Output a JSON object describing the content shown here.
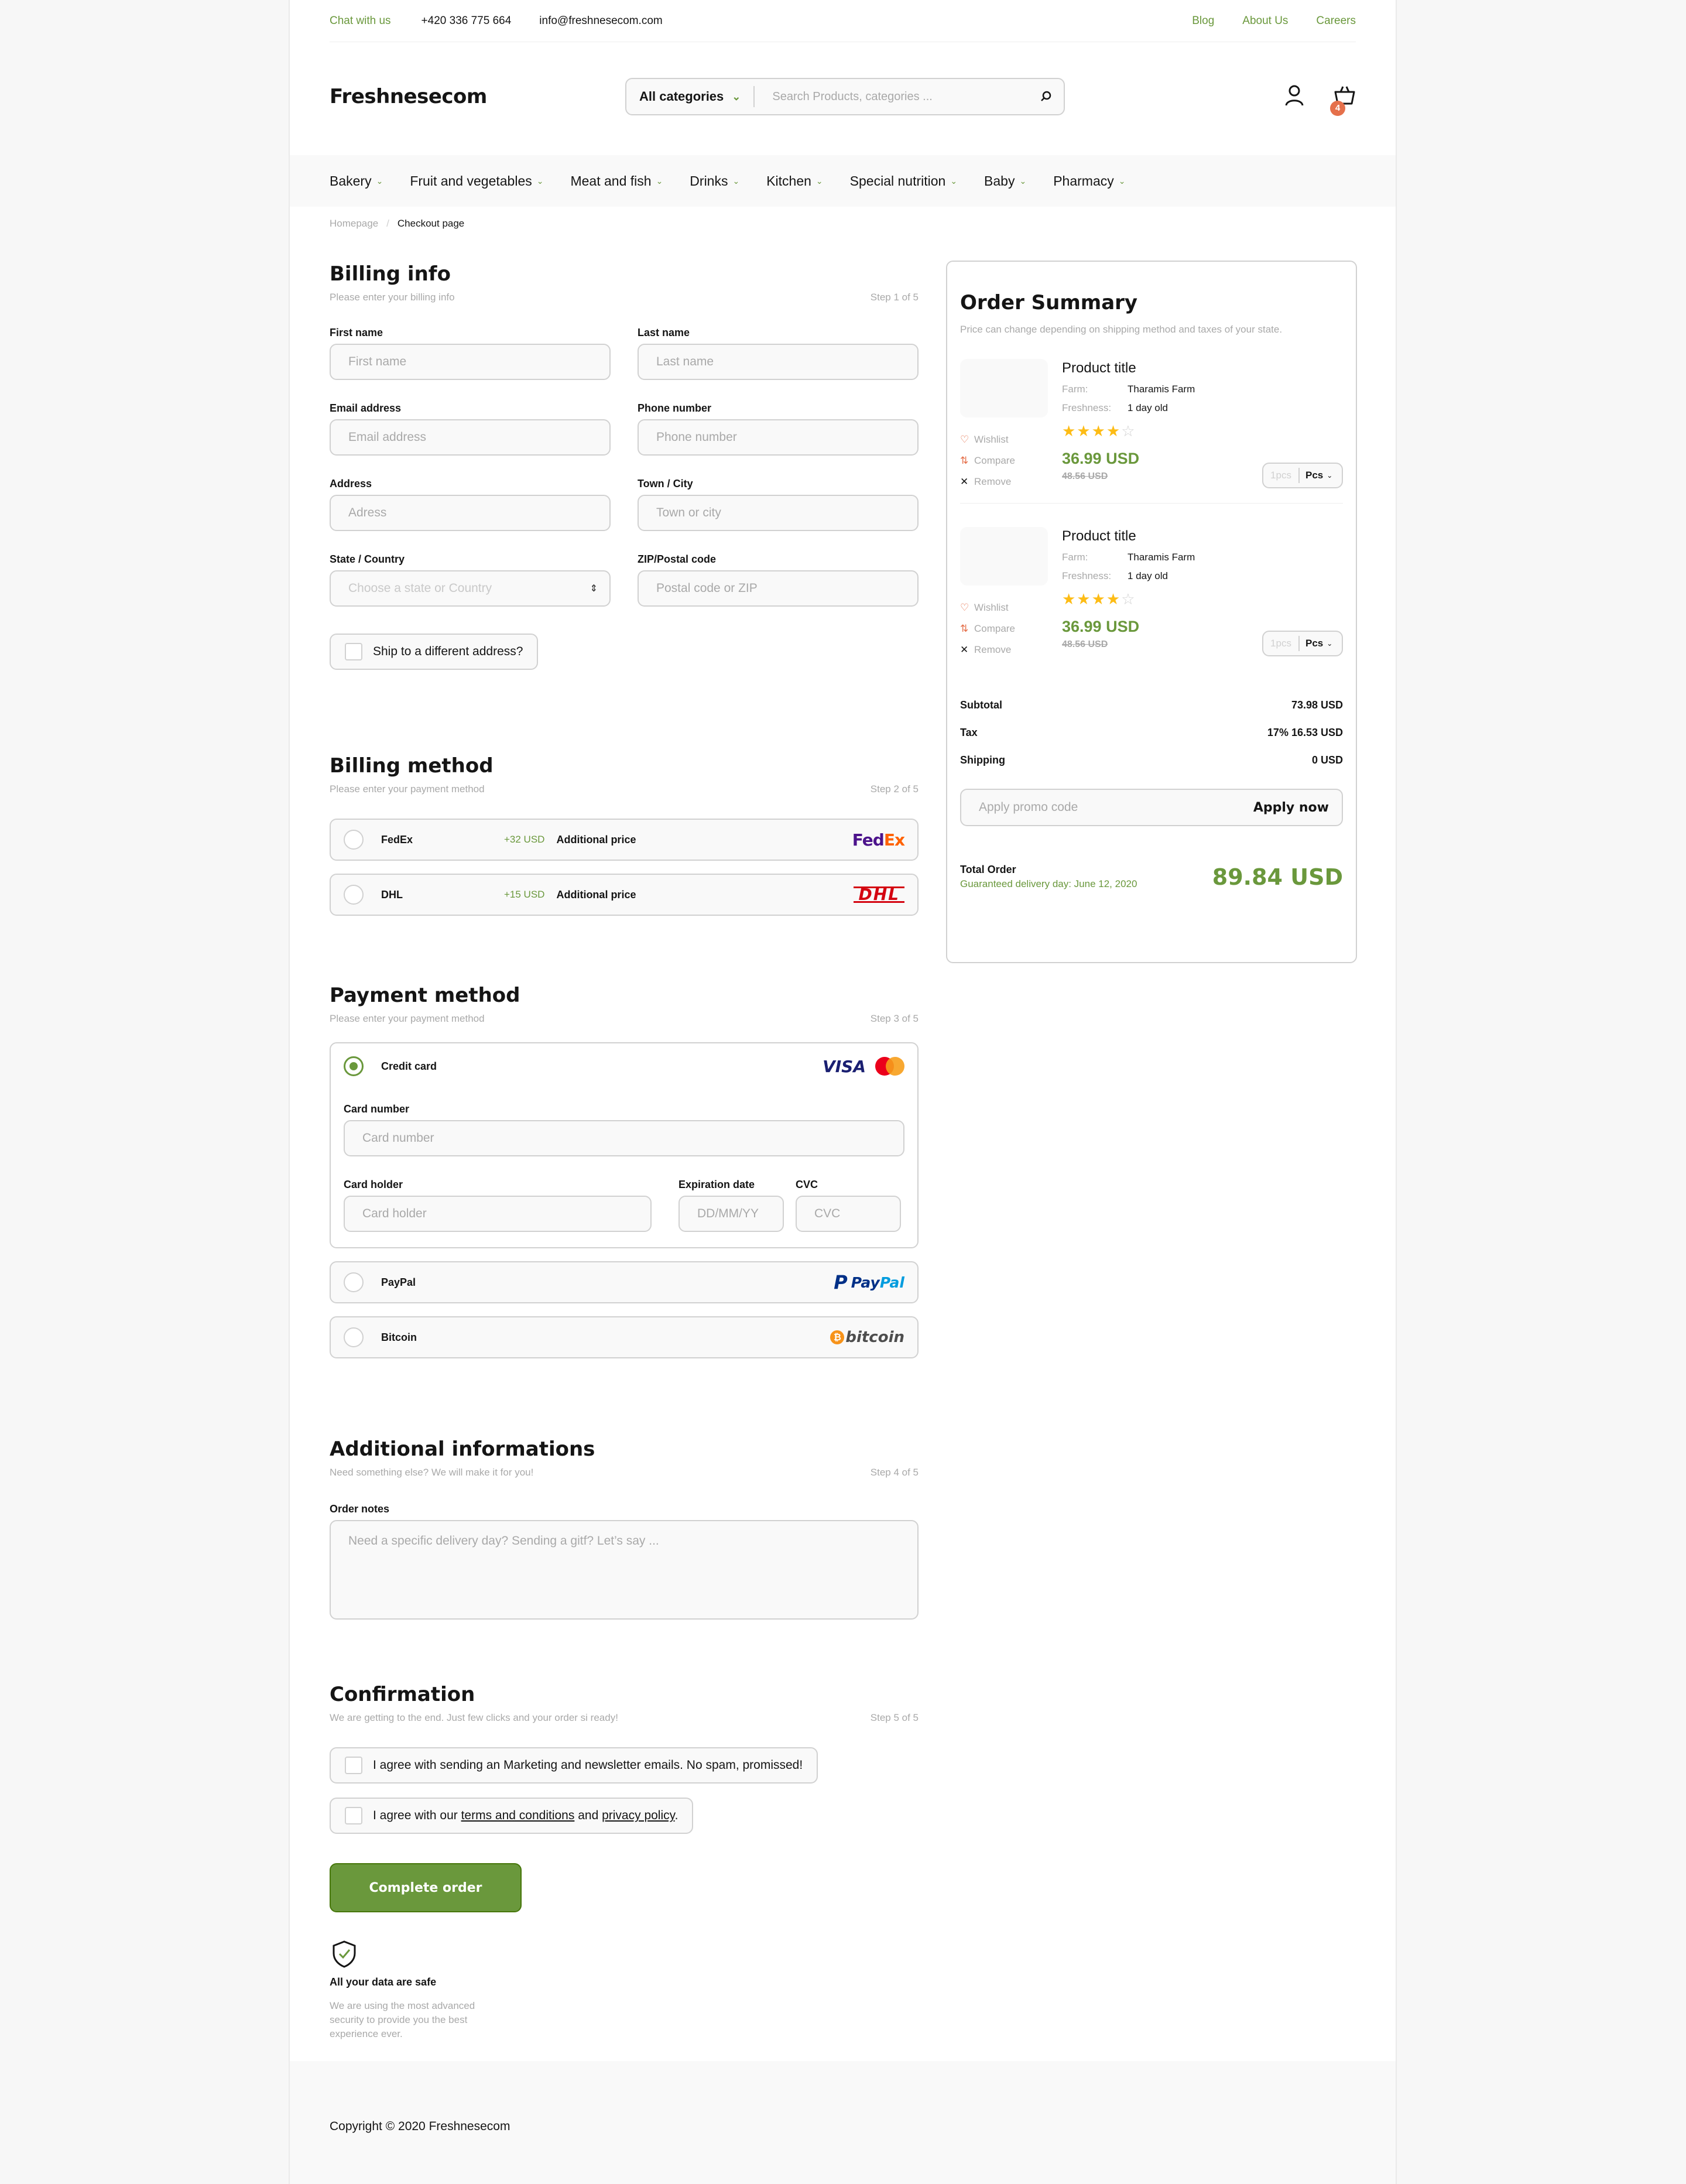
{
  "topbar": {
    "chat": "Chat with us",
    "phone": "+420 336 775 664",
    "email": "info@freshnesecom.com",
    "links": [
      "Blog",
      "About Us",
      "Careers"
    ]
  },
  "header": {
    "logo": "Freshnesecom",
    "category": "All categories",
    "search_placeholder": "Search Products, categories ...",
    "cart_count": "4"
  },
  "nav": [
    "Bakery",
    "Fruit and vegetables",
    "Meat and fish",
    "Drinks",
    "Kitchen",
    "Special nutrition",
    "Baby",
    "Pharmacy"
  ],
  "breadcrumb": {
    "home": "Homepage",
    "sep": "/",
    "current": "Checkout page"
  },
  "billing_info": {
    "title": "Billing info",
    "subtitle": "Please enter your billing info",
    "step": "Step 1 of 5",
    "fields": [
      {
        "label": "First name",
        "placeholder": "First name"
      },
      {
        "label": "Last name",
        "placeholder": "Last name"
      },
      {
        "label": "Email address",
        "placeholder": "Email address"
      },
      {
        "label": "Phone number",
        "placeholder": "Phone number"
      },
      {
        "label": "Address",
        "placeholder": "Adress"
      },
      {
        "label": "Town / City",
        "placeholder": "Town or city"
      },
      {
        "label": "State / Country",
        "placeholder": "Choose a state or Country"
      },
      {
        "label": "ZIP/Postal code",
        "placeholder": "Postal code or ZIP"
      }
    ],
    "ship_diff": "Ship to a different address?"
  },
  "billing_method": {
    "title": "Billing method",
    "subtitle": "Please enter your payment method",
    "step": "Step 2 of 5",
    "options": [
      {
        "name": "FedEx",
        "price": "+32 USD",
        "add": "Additional price",
        "logo": "FedEx"
      },
      {
        "name": "DHL",
        "price": "+15 USD",
        "add": "Additional price",
        "logo": "DHL"
      }
    ]
  },
  "payment_method": {
    "title": "Payment method",
    "subtitle": "Please enter your payment method",
    "step": "Step 3 of 5",
    "credit": "Credit card",
    "visa": "VISA",
    "card_number_label": "Card number",
    "card_number_ph": "Card number",
    "holder_label": "Card holder",
    "holder_ph": "Card holder",
    "exp_label": "Expiration date",
    "exp_ph": "DD/MM/YY",
    "cvc_label": "CVC",
    "cvc_ph": "CVC",
    "paypal": "PayPal",
    "paypal_logo_p": "Pay",
    "paypal_logo_s": "Pal",
    "bitcoin": "Bitcoin",
    "bitcoin_logo": "bitcoin"
  },
  "additional": {
    "title": "Additional informations",
    "subtitle": "Need something else? We will make it for you!",
    "step": "Step 4 of 5",
    "notes_label": "Order notes",
    "notes_ph": "Need a specific delivery day? Sending a gitf? Let’s say ..."
  },
  "confirmation": {
    "title": "Confirmation",
    "subtitle": "We are getting to the end. Just few clicks and your order si ready!",
    "step": "Step 5 of 5",
    "agree1": "I agree with sending an Marketing and newsletter emails. No spam, promissed!",
    "agree2_pre": "I agree with our ",
    "terms": "terms and conditions",
    "agree2_mid": " and ",
    "privacy": "privacy policy",
    "agree2_post": ".",
    "button": "Complete order"
  },
  "safe": {
    "title": "All your data are safe",
    "text": "We are using the most advanced security to provide you the best experience ever."
  },
  "summary": {
    "title": "Order Summary",
    "subtitle": "Price can change depending on shipping method and taxes of your state.",
    "products": [
      {
        "title": "Product title",
        "farm_k": "Farm:",
        "farm": "Tharamis Farm",
        "fresh_k": "Freshness:",
        "fresh": "1 day old",
        "rating": 4,
        "price": "36.99 USD",
        "old": "48.56 USD",
        "qty": "1pcs",
        "unit": "Pcs"
      },
      {
        "title": "Product title",
        "farm_k": "Farm:",
        "farm": "Tharamis Farm",
        "fresh_k": "Freshness:",
        "fresh": "1 day old",
        "rating": 4,
        "price": "36.99 USD",
        "old": "48.56 USD",
        "qty": "1pcs",
        "unit": "Pcs"
      }
    ],
    "actions": [
      "Wishlist",
      "Compare",
      "Remove"
    ],
    "subtotal_l": "Subtotal",
    "subtotal": "73.98 USD",
    "tax_l": "Tax",
    "tax": "17% 16.53 USD",
    "shipping_l": "Shipping",
    "shipping": "0 USD",
    "promo_ph": "Apply promo code",
    "promo_btn": "Apply now",
    "total_l": "Total Order",
    "delivery": "Guaranteed delivery day:  June 12, 2020",
    "total": "89.84 USD"
  },
  "footer": {
    "copyright": "Copyright © 2020 Freshnesecom"
  },
  "colors": {
    "accent": "#6a983c",
    "star": "#fdbc15",
    "badge": "#e5704b"
  }
}
